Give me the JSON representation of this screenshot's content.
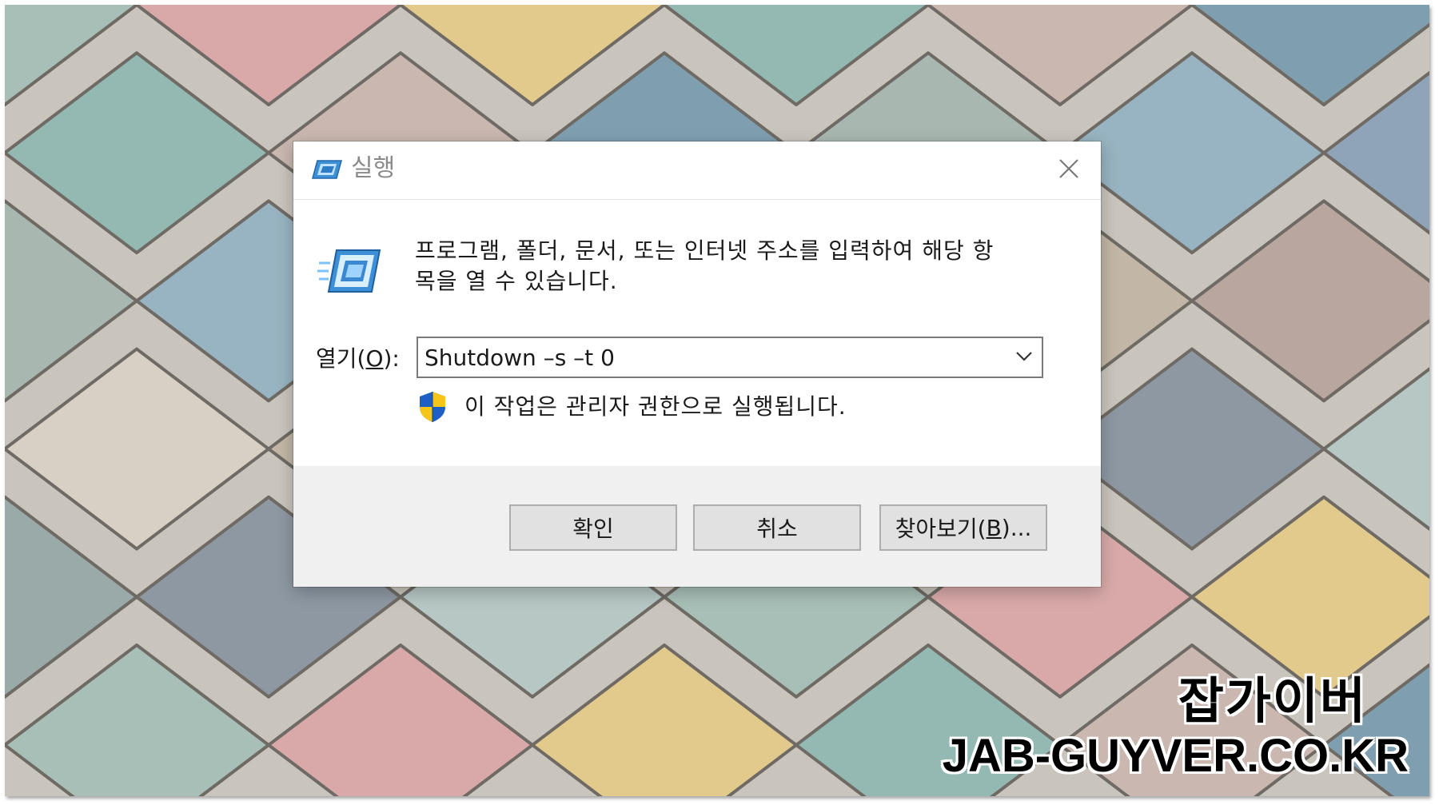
{
  "colors": {
    "accent": "#0078d7",
    "dialog_bg": "#ffffff",
    "footer_bg": "#f0f0f0",
    "button_bg": "#e1e1e1"
  },
  "dialog": {
    "title": "실행",
    "title_icon": "run-icon",
    "close_icon": "close-icon",
    "instructions_line1": "프로그램, 폴더, 문서, 또는 인터넷 주소를 입력하여 해당 항",
    "instructions_line2": "목을 열 수 있습니다.",
    "open_label_prefix": "열기(",
    "open_label_key": "O",
    "open_label_suffix": "):",
    "open_value": "Shutdown –s –t 0",
    "dropdown_icon": "chevron-down-icon",
    "admin_icon": "uac-shield-icon",
    "admin_note": "이 작업은 관리자 권한으로 실행됩니다.",
    "buttons": {
      "ok": "확인",
      "cancel": "취소",
      "browse_prefix": "찾아보기(",
      "browse_key": "B",
      "browse_suffix": ")..."
    }
  },
  "watermark": {
    "korean": "잡가이버",
    "url": "JAB-GUYVER.CO.KR"
  }
}
